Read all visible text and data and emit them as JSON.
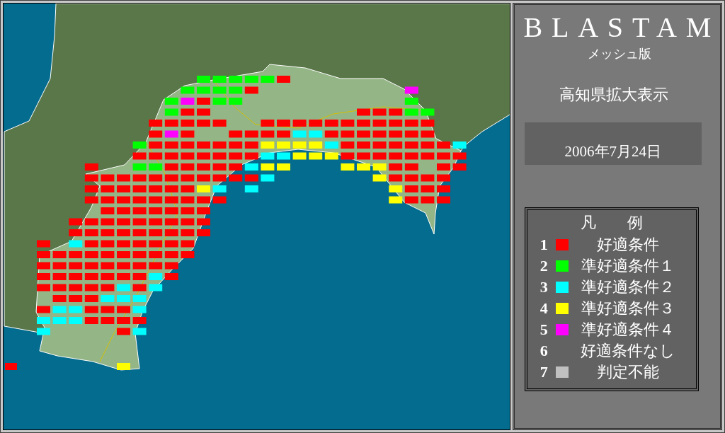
{
  "header": {
    "title": "BLASTAM",
    "subtitle": "メッシュ版",
    "region": "高知県拡大表示"
  },
  "date": "2006年7月24日",
  "legend": {
    "title": "凡　例",
    "items": [
      {
        "number": "1",
        "label": "好適条件",
        "color": "#ff0000"
      },
      {
        "number": "2",
        "label": "準好適条件１",
        "color": "#00ff00"
      },
      {
        "number": "3",
        "label": "準好適条件２",
        "color": "#00ffff"
      },
      {
        "number": "4",
        "label": "準好適条件３",
        "color": "#ffff00"
      },
      {
        "number": "5",
        "label": "準好適条件４",
        "color": "#ff00ff"
      },
      {
        "number": "6",
        "label": "好適条件なし"
      },
      {
        "number": "7",
        "label": "判定不能",
        "color": "#c0c0c0"
      }
    ]
  }
}
